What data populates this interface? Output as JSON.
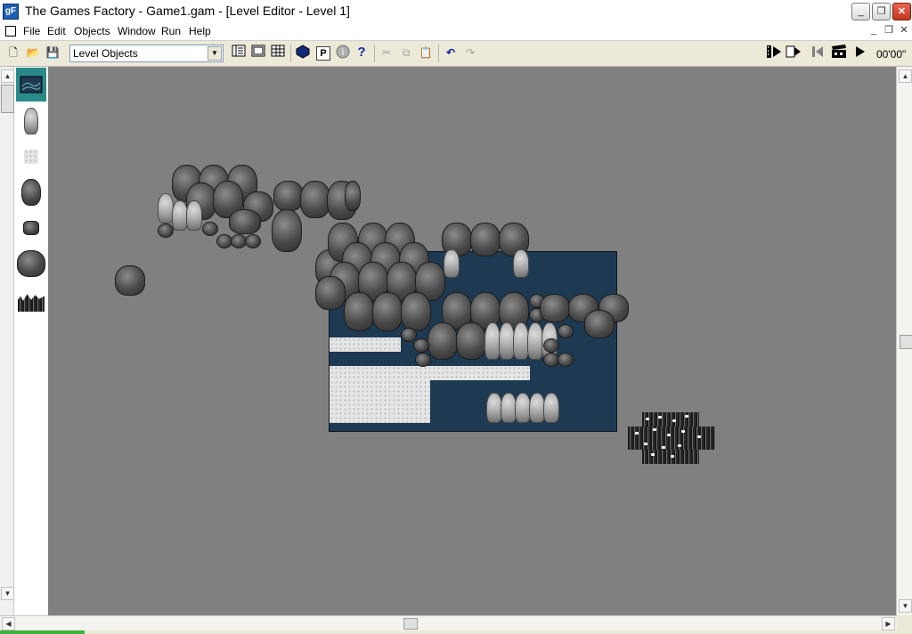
{
  "window": {
    "title": "The Games Factory - Game1.gam - [Level Editor - Level 1]",
    "app_icon_text": "gF",
    "controls": {
      "minimize": "_",
      "maximize": "❐",
      "close": "✕"
    }
  },
  "menu": {
    "items": [
      "File",
      "Edit",
      "Objects",
      "Window",
      "Run",
      "Help"
    ],
    "mdi_controls": {
      "minimize": "_",
      "restore": "❐",
      "close": "✕"
    }
  },
  "toolbar": {
    "object_list_selected": "Level Objects",
    "time": "00'00\"",
    "icons": {
      "new": "🗋",
      "open": "📂",
      "save": "💾",
      "cut": "✂",
      "copy": "⧉",
      "paste": "📋",
      "undo": "↶",
      "redo": "↷",
      "about": "?",
      "properties": "P",
      "info": "i"
    }
  },
  "objects_panel": {
    "items": [
      "backdrop",
      "pine-tree",
      "snow-tile",
      "tree",
      "rock",
      "bush",
      "grass"
    ]
  },
  "colors": {
    "canvas": "#808080",
    "water": "#1e3a52",
    "selection": "#2a8a8a"
  }
}
